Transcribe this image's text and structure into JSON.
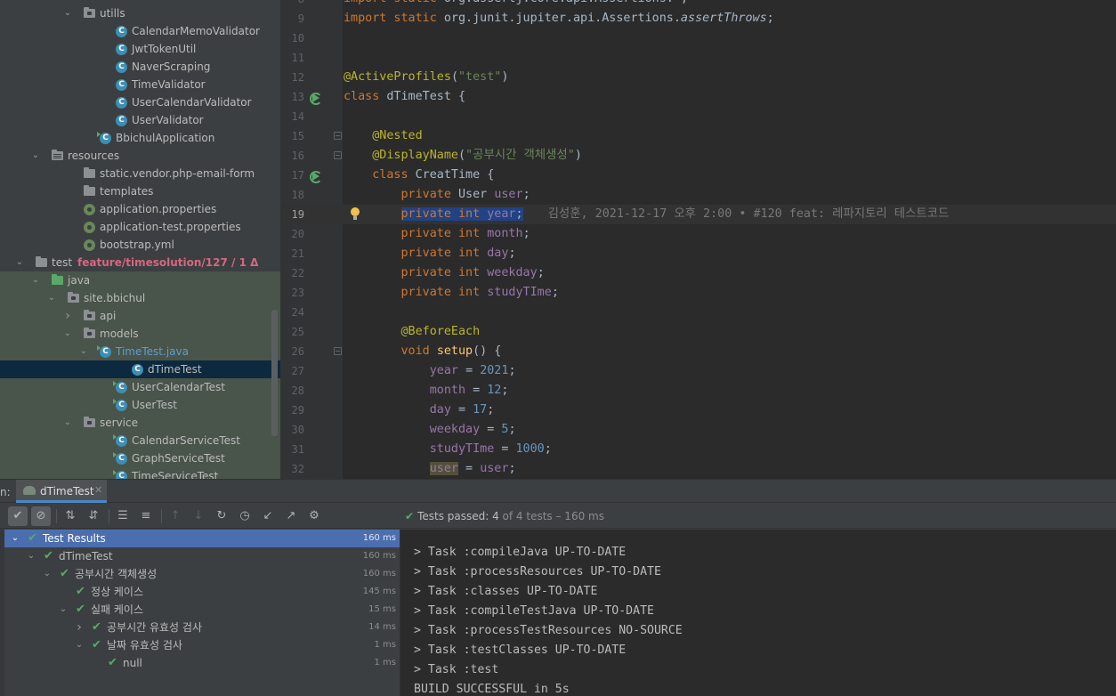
{
  "project_tree": {
    "rows": [
      {
        "label": "utills",
        "kind": "pkg",
        "indent": 4,
        "arrow": "down"
      },
      {
        "label": "CalendarMemoValidator",
        "kind": "class",
        "indent": 6
      },
      {
        "label": "JwtTokenUtil",
        "kind": "class",
        "indent": 6
      },
      {
        "label": "NaverScraping",
        "kind": "class",
        "indent": 6
      },
      {
        "label": "TimeValidator",
        "kind": "class",
        "indent": 6
      },
      {
        "label": "UserCalendarValidator",
        "kind": "class",
        "indent": 6
      },
      {
        "label": "UserValidator",
        "kind": "class",
        "indent": 6
      },
      {
        "label": "BbichulApplication",
        "kind": "class-run",
        "indent": 5
      },
      {
        "label": "resources",
        "kind": "res",
        "indent": 2,
        "arrow": "down"
      },
      {
        "label": "static.vendor.php-email-form",
        "kind": "folder",
        "indent": 4
      },
      {
        "label": "templates",
        "kind": "folder",
        "indent": 4
      },
      {
        "label": "application.properties",
        "kind": "spring",
        "indent": 4
      },
      {
        "label": "application-test.properties",
        "kind": "spring",
        "indent": 4
      },
      {
        "label": "bootstrap.yml",
        "kind": "spring",
        "indent": 4
      },
      {
        "label": "test",
        "kind": "folder",
        "indent": 1,
        "arrow": "down",
        "branch": "feature/timesolution/127 / 1 Δ"
      },
      {
        "label": "java",
        "kind": "green",
        "indent": 2,
        "arrow": "down"
      },
      {
        "label": "site.bbichul",
        "kind": "pkg",
        "indent": 3,
        "arrow": "down"
      },
      {
        "label": "api",
        "kind": "pkg",
        "indent": 4,
        "arrow": "right"
      },
      {
        "label": "models",
        "kind": "pkg",
        "indent": 4,
        "arrow": "down"
      },
      {
        "label": "TimeTest.java",
        "kind": "class-run",
        "indent": 5,
        "arrow": "down",
        "accent": true
      },
      {
        "label": "dTimeTest",
        "kind": "class",
        "indent": 7,
        "selected": true
      },
      {
        "label": "UserCalendarTest",
        "kind": "class-run",
        "indent": 6
      },
      {
        "label": "UserTest",
        "kind": "class-run",
        "indent": 6
      },
      {
        "label": "service",
        "kind": "pkg",
        "indent": 4,
        "arrow": "down"
      },
      {
        "label": "CalendarServiceTest",
        "kind": "class-run",
        "indent": 6
      },
      {
        "label": "GraphServiceTest",
        "kind": "class-run",
        "indent": 6
      },
      {
        "label": "TimeServiceTest",
        "kind": "class-run",
        "indent": 6
      }
    ],
    "class_icon_letter": "C"
  },
  "editor": {
    "current_line": "19",
    "lines": [
      {
        "n": "8",
        "html": "<span class=\"kw\">import static </span>org.assertj.core.api.Assertions.<span class=\"it\">*</span>;"
      },
      {
        "n": "9",
        "html": "<span class=\"kw\">import static </span>org.junit.jupiter.api.Assertions.<span class=\"it\">assertThrows</span>;"
      },
      {
        "n": "10",
        "html": ""
      },
      {
        "n": "11",
        "html": ""
      },
      {
        "n": "12",
        "html": "<span class=\"ann\">@ActiveProfiles</span>(<span class=\"str\">\"test\"</span>)"
      },
      {
        "n": "13",
        "html": "<span class=\"kw\">class </span>dTimeTest {",
        "run": true
      },
      {
        "n": "14",
        "html": ""
      },
      {
        "n": "15",
        "html": "    <span class=\"ann\">@Nested</span>",
        "fold": true
      },
      {
        "n": "16",
        "html": "    <span class=\"ann\">@DisplayName</span>(<span class=\"str\">\"공부시간 객체생성\"</span>)",
        "fold": true
      },
      {
        "n": "17",
        "html": "    <span class=\"kw\">class </span>CreatTime {",
        "run": true
      },
      {
        "n": "18",
        "html": "        <span class=\"kw\">private </span>User <span class=\"field\">user</span>;"
      },
      {
        "n": "19",
        "html": "        <span class=\"sel\"><span class=\"kw\">private int </span><span class=\"field\">year</span>;</span><span class=\"blame\">김성훈, 2021-12-17 오후 2:00 • #120 feat: 레파지토리 테스트코드</span>",
        "bulb": true
      },
      {
        "n": "20",
        "html": "        <span class=\"kw\">private int </span><span class=\"field\">month</span>;"
      },
      {
        "n": "21",
        "html": "        <span class=\"kw\">private int </span><span class=\"field\">day</span>;"
      },
      {
        "n": "22",
        "html": "        <span class=\"kw\">private int </span><span class=\"field\">weekday</span>;"
      },
      {
        "n": "23",
        "html": "        <span class=\"kw\">private int </span><span class=\"field\">studyTIme</span>;"
      },
      {
        "n": "24",
        "html": ""
      },
      {
        "n": "25",
        "html": "        <span class=\"ann\">@BeforeEach</span>"
      },
      {
        "n": "26",
        "html": "        <span class=\"kw\">void </span><span class=\"fn\">setup</span>() {",
        "fold": true
      },
      {
        "n": "27",
        "html": "            <span class=\"field\">year </span>= <span class=\"num\">2021</span>;"
      },
      {
        "n": "28",
        "html": "            <span class=\"field\">month </span>= <span class=\"num\">12</span>;"
      },
      {
        "n": "29",
        "html": "            <span class=\"field\">day </span>= <span class=\"num\">17</span>;"
      },
      {
        "n": "30",
        "html": "            <span class=\"field\">weekday </span>= <span class=\"num\">5</span>;"
      },
      {
        "n": "31",
        "html": "            <span class=\"field\">studyTIme </span>= <span class=\"num\">1000</span>;"
      },
      {
        "n": "32",
        "html": "            <span class=\"field hl-user\">user</span> = <span class=\"field\">user</span>;"
      }
    ]
  },
  "run_panel": {
    "label": "n:",
    "tab": {
      "name": "dTimeTest",
      "close": "✕"
    },
    "status": {
      "prefix": "Tests passed: ",
      "passed": "4",
      "rest": " of 4 tests – 160 ms",
      "check": "✔"
    },
    "toolbar": [
      {
        "name": "show-passed-button",
        "glyph": "✔",
        "on": true
      },
      {
        "name": "show-ignored-button",
        "glyph": "⊘",
        "on": true
      },
      {
        "name": "sort-alpha-button",
        "glyph": "⇅",
        "sep_before": true
      },
      {
        "name": "sort-duration-button",
        "glyph": "⇵"
      },
      {
        "name": "expand-all-button",
        "glyph": "☰",
        "sep_before": true
      },
      {
        "name": "collapse-all-button",
        "glyph": "≡"
      },
      {
        "name": "prev-failed-button",
        "glyph": "↑",
        "dim": true,
        "sep_before": true
      },
      {
        "name": "next-failed-button",
        "glyph": "↓",
        "dim": true
      },
      {
        "name": "rerun-button",
        "glyph": "↻"
      },
      {
        "name": "history-button",
        "glyph": "◷"
      },
      {
        "name": "import-button",
        "glyph": "↙"
      },
      {
        "name": "export-button",
        "glyph": "↗"
      },
      {
        "name": "settings-button",
        "glyph": "⚙"
      }
    ],
    "results": [
      {
        "label": "Test Results",
        "time": "160 ms",
        "indent": 0,
        "arrow": "down",
        "selected": true
      },
      {
        "label": "dTimeTest",
        "time": "160 ms",
        "indent": 1,
        "arrow": "down"
      },
      {
        "label": "공부시간 객체생성",
        "time": "160 ms",
        "indent": 2,
        "arrow": "down"
      },
      {
        "label": "정상 케이스",
        "time": "145 ms",
        "indent": 3
      },
      {
        "label": "실패 케이스",
        "time": "15 ms",
        "indent": 3,
        "arrow": "down"
      },
      {
        "label": "공부시간 유효성 검사",
        "time": "14 ms",
        "indent": 4,
        "arrow": "right"
      },
      {
        "label": "날짜 유효성 검사",
        "time": "1 ms",
        "indent": 4,
        "arrow": "down"
      },
      {
        "label": "null",
        "time": "1 ms",
        "indent": 5
      }
    ],
    "check_glyph": "✔",
    "console": [
      "",
      "> Task :compileJava UP-TO-DATE",
      "> Task :processResources UP-TO-DATE",
      "> Task :classes UP-TO-DATE",
      "> Task :compileTestJava UP-TO-DATE",
      "> Task :processTestResources NO-SOURCE",
      "> Task :testClasses UP-TO-DATE",
      "> Task :test",
      "BUILD SUCCESSFUL in 5s"
    ]
  }
}
